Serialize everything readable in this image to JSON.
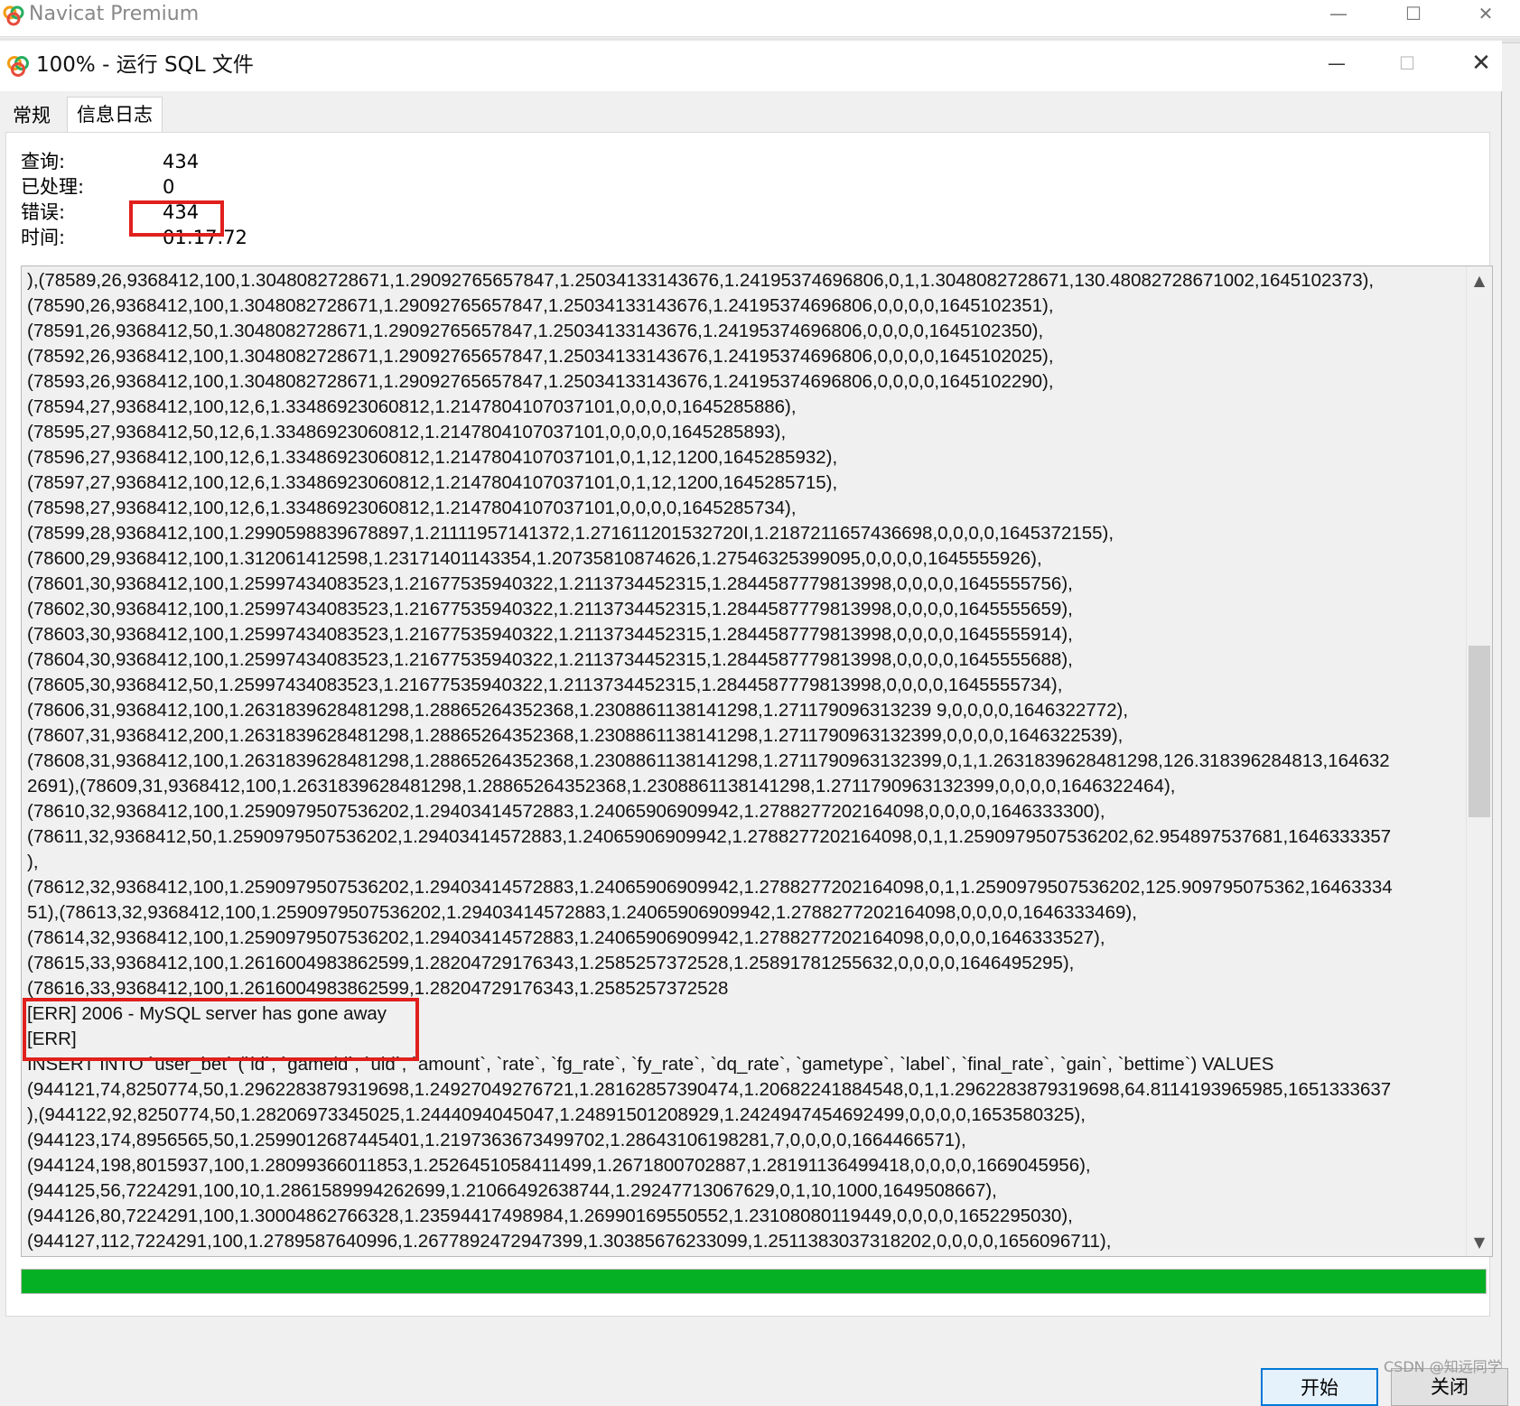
{
  "app": {
    "title": "Navicat Premium"
  },
  "dialog": {
    "title": "100% - 运行 SQL 文件"
  },
  "tabs": [
    {
      "label": "常规"
    },
    {
      "label": "信息日志"
    }
  ],
  "stats": {
    "queries": {
      "label": "查询:",
      "value": "434"
    },
    "processed": {
      "label": "已处理:",
      "value": "0"
    },
    "errors": {
      "label": "错误:",
      "value": "434"
    },
    "time": {
      "label": "时间:",
      "value": "01:17.72"
    }
  },
  "log_lines": [
    "),(78589,26,9368412,100,1.3048082728671,1.29092765657847,1.25034133143676,1.24195374696806,0,1,1.3048082728671,130.48082728671002,1645102373),",
    "(78590,26,9368412,100,1.3048082728671,1.29092765657847,1.25034133143676,1.24195374696806,0,0,0,0,1645102351),",
    "(78591,26,9368412,50,1.3048082728671,1.29092765657847,1.25034133143676,1.24195374696806,0,0,0,0,1645102350),",
    "(78592,26,9368412,100,1.3048082728671,1.29092765657847,1.25034133143676,1.24195374696806,0,0,0,0,1645102025),",
    "(78593,26,9368412,100,1.3048082728671,1.29092765657847,1.25034133143676,1.24195374696806,0,0,0,0,1645102290),",
    "(78594,27,9368412,100,12,6,1.33486923060812,1.2147804107037101,0,0,0,0,1645285886),",
    "(78595,27,9368412,50,12,6,1.33486923060812,1.2147804107037101,0,0,0,0,1645285893),",
    "(78596,27,9368412,100,12,6,1.33486923060812,1.2147804107037101,0,1,12,1200,1645285932),",
    "(78597,27,9368412,100,12,6,1.33486923060812,1.2147804107037101,0,1,12,1200,1645285715),",
    "(78598,27,9368412,100,12,6,1.33486923060812,1.2147804107037101,0,0,0,0,1645285734),",
    "(78599,28,9368412,100,1.2990598839678897,1.21111957141372,1.271611201532720I,1.2187211657436698,0,0,0,0,1645372155),",
    "(78600,29,9368412,100,1.312061412598,1.23171401143354,1.20735810874626,1.27546325399095,0,0,0,0,1645555926),",
    "(78601,30,9368412,100,1.25997434083523,1.21677535940322,1.2113734452315,1.2844587779813998,0,0,0,0,1645555756),",
    "(78602,30,9368412,100,1.25997434083523,1.21677535940322,1.2113734452315,1.2844587779813998,0,0,0,0,1645555659),",
    "(78603,30,9368412,100,1.25997434083523,1.21677535940322,1.2113734452315,1.2844587779813998,0,0,0,0,1645555914),",
    "(78604,30,9368412,100,1.25997434083523,1.21677535940322,1.2113734452315,1.2844587779813998,0,0,0,0,1645555688),",
    "(78605,30,9368412,50,1.25997434083523,1.21677535940322,1.2113734452315,1.2844587779813998,0,0,0,0,1645555734),",
    "(78606,31,9368412,100,1.2631839628481298,1.28865264352368,1.2308861138141298,1.271179096313239 9,0,0,0,0,1646322772),",
    "(78607,31,9368412,200,1.2631839628481298,1.28865264352368,1.2308861138141298,1.2711790963132399,0,0,0,0,1646322539),",
    "(78608,31,9368412,100,1.2631839628481298,1.28865264352368,1.2308861138141298,1.2711790963132399,0,1,1.2631839628481298,126.318396284813,164632",
    "2691),(78609,31,9368412,100,1.2631839628481298,1.28865264352368,1.2308861138141298,1.2711790963132399,0,0,0,0,1646322464),",
    "(78610,32,9368412,100,1.2590979507536202,1.29403414572883,1.24065906909942,1.2788277202164098,0,0,0,0,1646333300),",
    "(78611,32,9368412,50,1.2590979507536202,1.29403414572883,1.24065906909942,1.2788277202164098,0,1,1.2590979507536202,62.954897537681,1646333357",
    "),",
    "(78612,32,9368412,100,1.2590979507536202,1.29403414572883,1.24065906909942,1.2788277202164098,0,1,1.2590979507536202,125.909795075362,16463334",
    "51),(78613,32,9368412,100,1.2590979507536202,1.29403414572883,1.24065906909942,1.2788277202164098,0,0,0,0,1646333469),",
    "(78614,32,9368412,100,1.2590979507536202,1.29403414572883,1.24065906909942,1.2788277202164098,0,0,0,0,1646333527),",
    "(78615,33,9368412,100,1.2616004983862599,1.28204729176343,1.2585257372528,1.25891781255632,0,0,0,0,1646495295),",
    "(78616,33,9368412,100,1.2616004983862599,1.28204729176343,1.2585257372528",
    "[ERR] 2006 - MySQL server has gone away",
    "[ERR]",
    "INSERT INTO `user_bet` (`id`, `gameid`, `uid`, `amount`, `rate`, `fg_rate`, `fy_rate`, `dq_rate`, `gametype`, `label`, `final_rate`, `gain`, `bettime`) VALUES",
    "(944121,74,8250774,50,1.2962283879319698,1.24927049276721,1.28162857390474,1.20682241884548,0,1,1.2962283879319698,64.8114193965985,1651333637",
    "),(944122,92,8250774,50,1.28206973345025,1.2444094045047,1.24891501208929,1.2424947454692499,0,0,0,0,1653580325),",
    "(944123,174,8956565,50,1.2599012687445401,1.2197363673499702,1.28643106198281,7,0,0,0,0,1664466571),",
    "(944124,198,8015937,100,1.28099366011853,1.2526451058411499,1.2671800702887,1.28191136499418,0,0,0,0,1669045956),",
    "(944125,56,7224291,100,10,1.2861589994262699,1.21066492638744,1.29247713067629,0,1,10,1000,1649508667),",
    "(944126,80,7224291,100,1.30004862766328,1.23594417498984,1.26990169550552,1.23108080119449,0,0,0,0,1652295030),",
    "(944127,112,7224291,100,1.2789587640996,1.2677892472947399,1.30385676233099,1.2511383037318202,0,0,0,0,1656096711),"
  ],
  "progress": {
    "fraction": 1.0,
    "color": "#06b025"
  },
  "buttons": {
    "start": "开始",
    "close": "关闭"
  },
  "window_controls": {
    "minimize": "—",
    "maximize": "☐",
    "close": "✕"
  },
  "watermark": "CSDN @知远同学",
  "colors": {
    "highlight": "#e0201d",
    "accent": "#0078d7"
  }
}
